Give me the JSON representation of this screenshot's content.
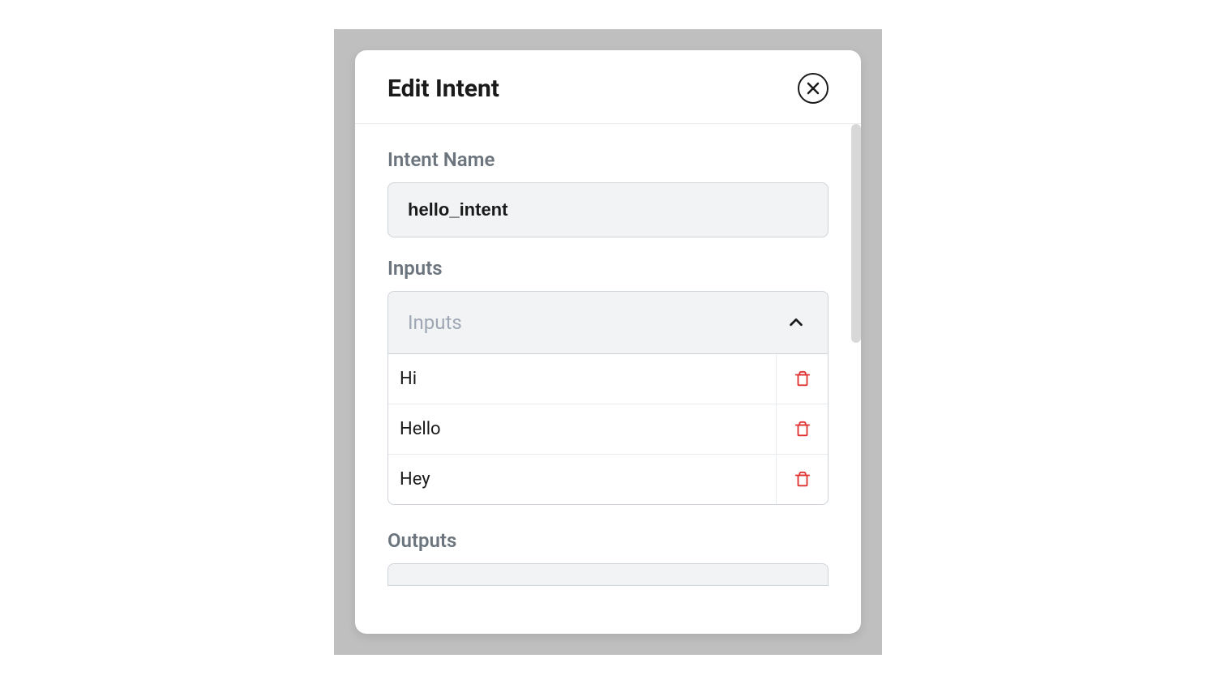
{
  "modal": {
    "title": "Edit Intent",
    "fields": {
      "intent_name_label": "Intent Name",
      "intent_name_value": "hello_intent",
      "inputs_label": "Inputs",
      "inputs_header": "Inputs",
      "inputs_items": [
        "Hi",
        "Hello",
        "Hey"
      ],
      "outputs_label": "Outputs"
    }
  }
}
